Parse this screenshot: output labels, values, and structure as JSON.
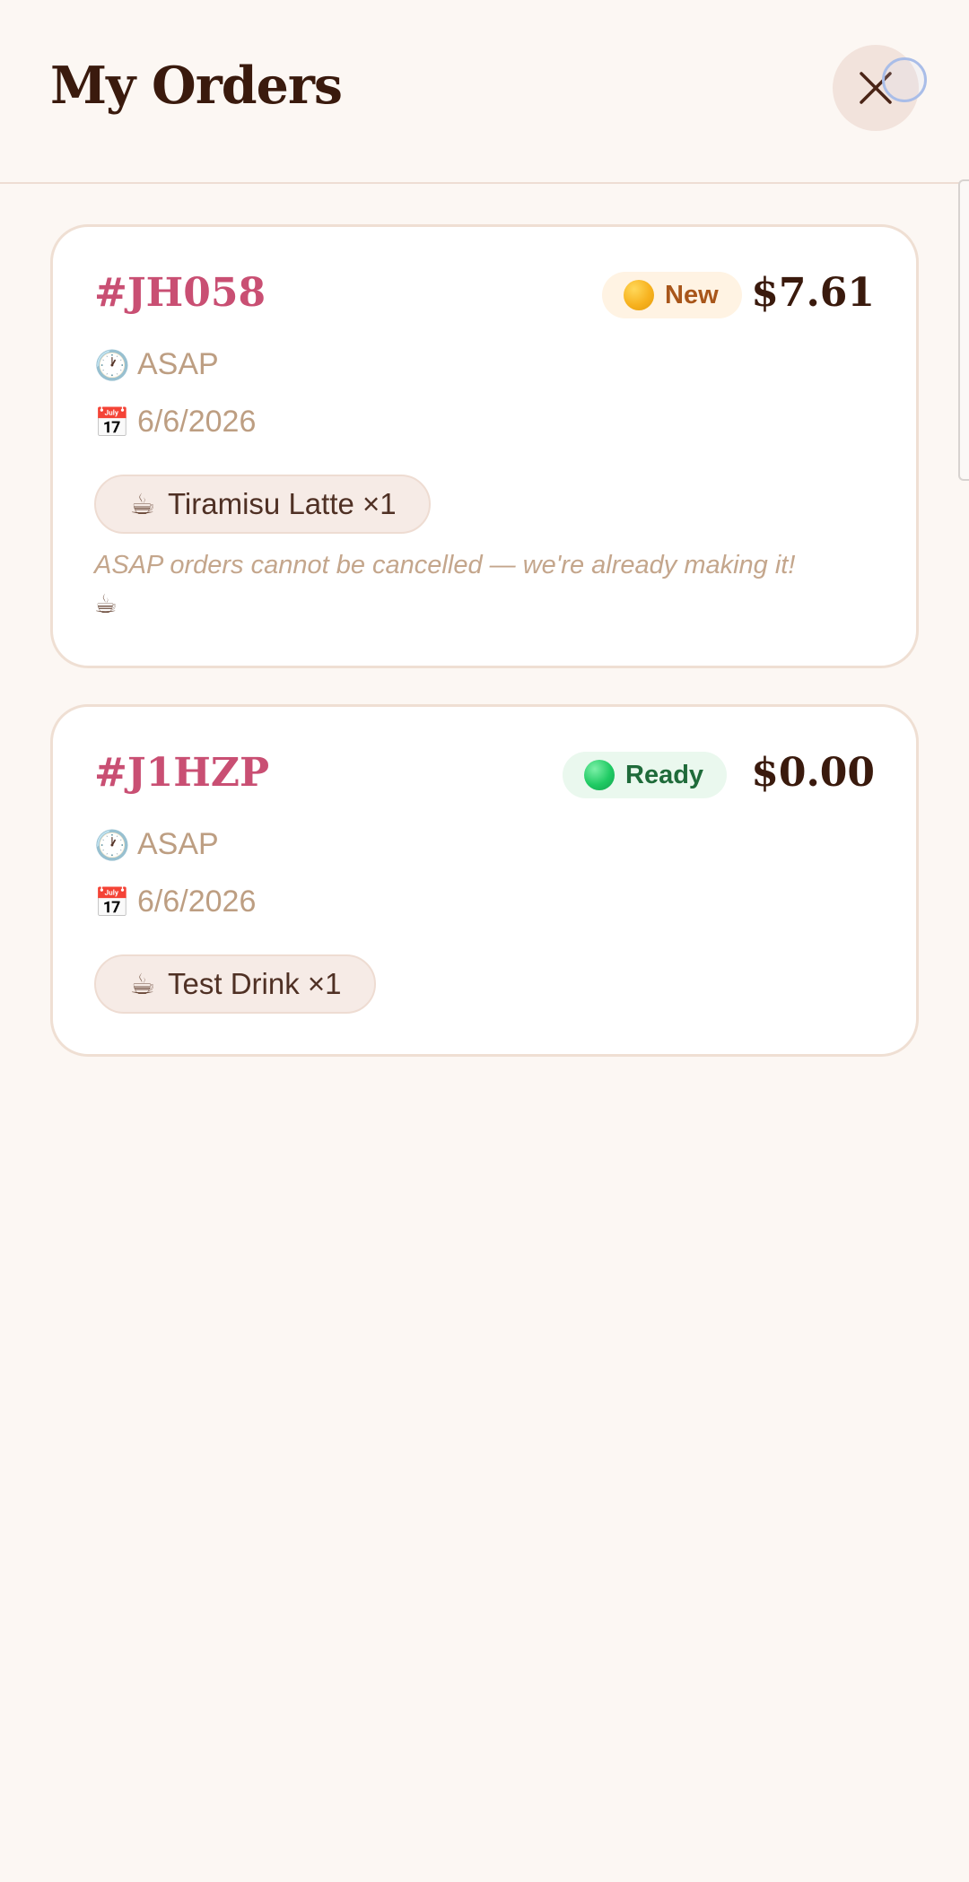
{
  "header": {
    "title": "My Orders",
    "close_icon": "close-icon"
  },
  "orders": [
    {
      "id": "#JH058",
      "status": "New",
      "status_color": "#f7b21f",
      "price": "$7.61",
      "time_icon": "🕐",
      "time": "ASAP",
      "date_icon": "📅",
      "date": "6/6/2026",
      "items": [
        {
          "icon": "☕",
          "label": "Tiramisu Latte ×1"
        }
      ],
      "note": "ASAP orders cannot be cancelled — we're already making it!",
      "note_icon": "☕"
    },
    {
      "id": "#J1HZP",
      "status": "Ready",
      "status_color": "#1fca63",
      "price": "$0.00",
      "time_icon": "🕐",
      "time": "ASAP",
      "date_icon": "📅",
      "date": "6/6/2026",
      "items": [
        {
          "icon": "☕",
          "label": "Test Drink ×1"
        }
      ]
    }
  ],
  "colors": {
    "background": "#fcf7f3",
    "order_id": "#c94f73",
    "price": "#3a1a0d",
    "meta_text": "#bd9e82"
  }
}
